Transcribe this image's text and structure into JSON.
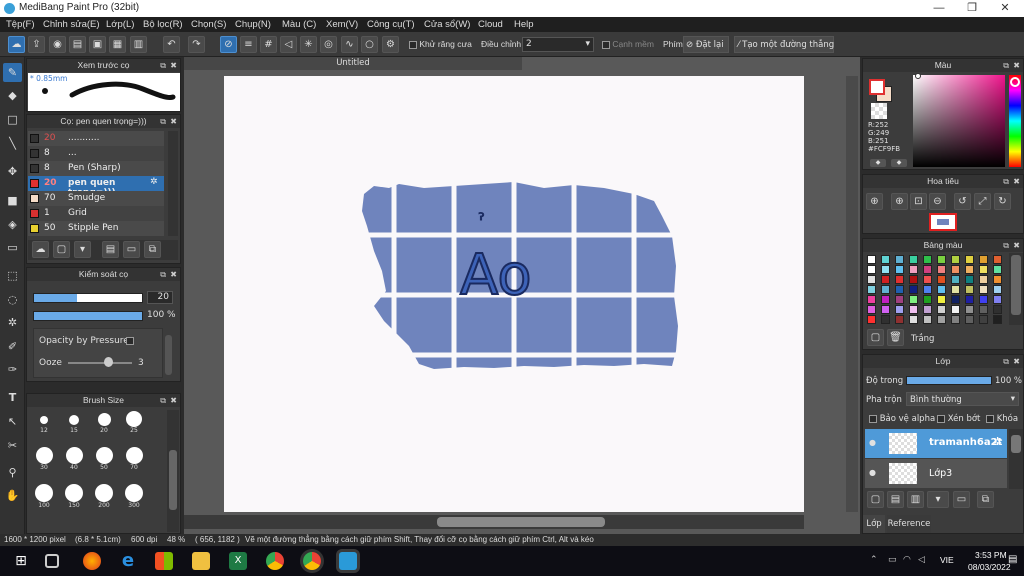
{
  "window": {
    "title": "MediBang Paint Pro (32bit)",
    "minimize": "—",
    "maximize": "❐",
    "close": "✕"
  },
  "menu": [
    "Tệp(F)",
    "Chỉnh sửa(E)",
    "Lớp(L)",
    "Bộ lọc(R)",
    "Chọn(S)",
    "Chụp(N)",
    "Màu (C)",
    "Xem(V)",
    "Công cụ(T)",
    "Cửa sổ(W)",
    "Cloud",
    "Help"
  ],
  "toolbar": {
    "antialias_label": "Khử răng cưa",
    "adjust_label": "Điều chỉnh",
    "adjust_value": "2",
    "margin_label": "Cạnh mềm",
    "key_label": "Phím",
    "reset_label": "Đặt lại",
    "line_label": "Tạo một đường thẳng"
  },
  "brush_preview": {
    "title": "Xem trước cọ",
    "size": "* 0.85mm"
  },
  "brush_list": {
    "title": "Cọ: pen quen trọng=)))",
    "items": [
      {
        "size": "20",
        "name": "...........",
        "color": "#333333"
      },
      {
        "size": "8",
        "name": "...",
        "color": "#333333"
      },
      {
        "size": "8",
        "name": "Pen (Sharp)",
        "color": "#333333"
      },
      {
        "size": "20",
        "name": "pen quen trọng=)))",
        "color": "#e03030"
      },
      {
        "size": "70",
        "name": "Smudge",
        "color": "#f5dcc8"
      },
      {
        "size": "1",
        "name": "Grid",
        "color": "#d83030"
      },
      {
        "size": "50",
        "name": "Stipple Pen",
        "color": "#e8d030"
      }
    ]
  },
  "brush_control": {
    "title": "Kiểm soát cọ",
    "size_value": "20",
    "opacity_value": "100 %",
    "opacity_pressure": "Opacity by Pressure",
    "ooze_label": "Ooze",
    "ooze_value": "3"
  },
  "brush_size": {
    "title": "Brush Size",
    "sizes": [
      "12",
      "15",
      "20",
      "25",
      "30",
      "40",
      "50",
      "70",
      "100",
      "150",
      "200",
      "300"
    ]
  },
  "document": {
    "tab": "Untitled",
    "drawing_text": "Ao"
  },
  "color_panel": {
    "title": "Màu",
    "r": "R:252",
    "g": "G:249",
    "b": "B:251",
    "hex": "#FCF9FB"
  },
  "navigator": {
    "title": "Hoa tiêu"
  },
  "palette": {
    "title": "Bảng màu",
    "swatch_label": "Trắng",
    "colors": [
      "#ffffff",
      "#5fd3d3",
      "#5fb0d3",
      "#3ad0a0",
      "#2ec04a",
      "#7ad040",
      "#b0d040",
      "#e0d040",
      "#e0a030",
      "#e06030",
      "#ffffff",
      "#90e0f0",
      "#60c0f0",
      "#f0a0c0",
      "#d04080",
      "#f08080",
      "#f09060",
      "#f0b060",
      "#f0e060",
      "#60e0a0",
      "#e0e0e0",
      "#d02020",
      "#e03030",
      "#b01010",
      "#f05050",
      "#e05020",
      "#50b0c0",
      "#108080",
      "#f0d0a0",
      "#f09030",
      "#80d0e0",
      "#60b0d0",
      "#2060b0",
      "#102080",
      "#5080f0",
      "#60c0f0",
      "#e0e0a0",
      "#c0c060",
      "#f0e0c0",
      "#a0d0f0",
      "#f040a0",
      "#c020c0",
      "#a04080",
      "#80f080",
      "#20a020",
      "#f0f040",
      "#102060",
      "#2020a0",
      "#4040f0",
      "#8080f0",
      "#e060e0",
      "#d060f0",
      "#a0a0f0",
      "#f0c0f0",
      "#c0a0d0",
      "#d0d0d0",
      "#f0f0f0",
      "#909090",
      "#606060",
      "#303030",
      "#ff3030",
      "#303030",
      "#903030",
      "#e0e0e0",
      "#c0c0c0",
      "#a0a0a0",
      "#808080",
      "#606060",
      "#404040",
      "#202020"
    ]
  },
  "layers": {
    "title": "Lớp",
    "opacity_label": "Độ trong",
    "opacity_value": "100 %",
    "blend_label": "Pha trộn",
    "blend_value": "Bình thường",
    "protect_alpha": "Bảo vệ alpha",
    "clip": "Xén bớt",
    "lock": "Khóa",
    "items": [
      {
        "name": "tramanh6a2t"
      },
      {
        "name": "Lớp3"
      }
    ],
    "tab_layer": "Lớp",
    "tab_reference": "Reference"
  },
  "status": {
    "size": "1600 * 1200 pixel",
    "cm": "(6.8 * 5.1cm)",
    "dpi": "600 dpi",
    "zoom": "48 %",
    "coords": "( 656, 1182 )",
    "hint": "Vẽ một đường thẳng bằng cách giữ phím Shift, Thay đổi cỡ cọ bằng cách giữ phím Ctrl, Alt và kéo"
  },
  "taskbar": {
    "lang": "VIE",
    "time": "3:53 PM",
    "date": "08/03/2022"
  }
}
